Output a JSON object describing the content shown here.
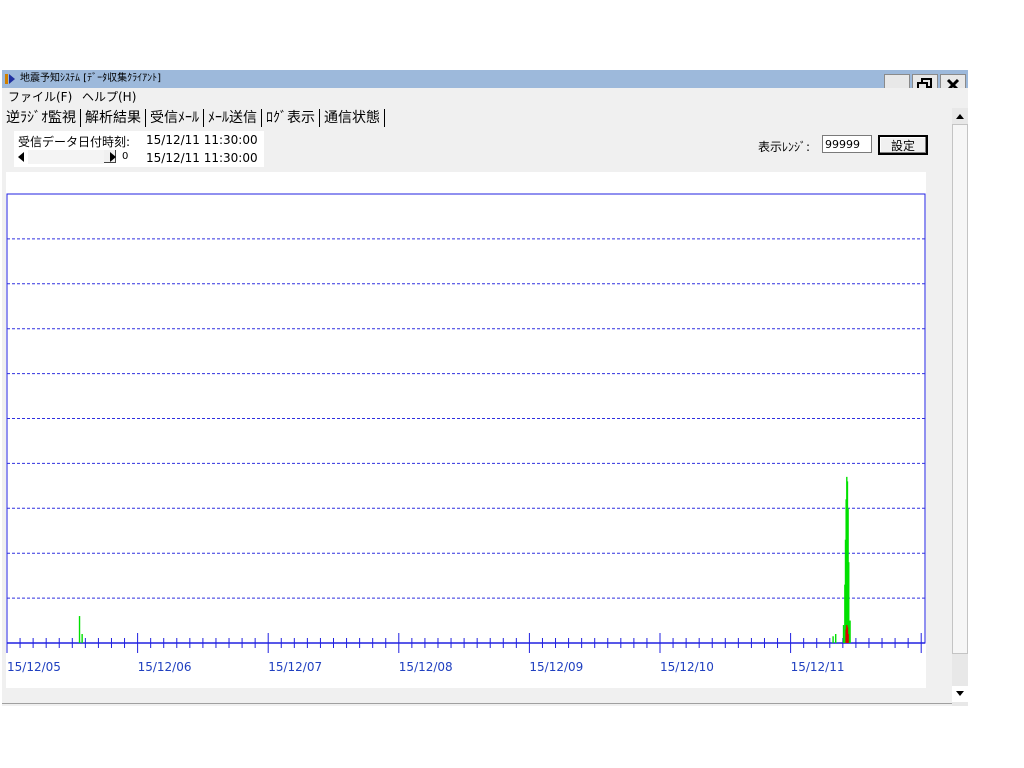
{
  "window": {
    "title": "地震予知ｼｽﾃﾑ [ﾃﾞｰﾀ収集ｸﾗｲｱﾝﾄ]"
  },
  "menu": {
    "items": [
      "ファイル(F)",
      "ヘルプ(H)"
    ]
  },
  "tabs": [
    "逆ﾗｼﾞｵ監視",
    "解析結果",
    "受信ﾒｰﾙ",
    "ﾒｰﾙ送信",
    "ﾛｸﾞ表示",
    "通信状態"
  ],
  "info": {
    "received_label": "受信データ日付時刻:",
    "received_time": "15/12/11 11:30:00",
    "slider_value": "0",
    "current_time": "15/12/11 11:30:00"
  },
  "controls": {
    "range_label": "表示ﾚﾝｼﾞ:",
    "range_value": "99999",
    "set_label": "設定"
  },
  "colors": {
    "titlebar": "#9db9db",
    "axis": "#2020e0",
    "grid": "#3030e0",
    "tick_label": "#2040c0",
    "series_green": "#00e000",
    "series_red": "#e00000"
  },
  "chart_data": {
    "type": "bar",
    "x_tick_labels": [
      "15/12/05",
      "15/12/06",
      "15/12/07",
      "15/12/08",
      "15/12/09",
      "15/12/10",
      "15/12/11"
    ],
    "x_range_days": [
      0,
      7
    ],
    "ylim": [
      0,
      1
    ],
    "grid_lines": 9,
    "minor_ticks_per_day": 10,
    "series": [
      {
        "color": "green",
        "points": [
          {
            "t": 0.55,
            "v": 0.06
          },
          {
            "t": 0.57,
            "v": 0.02
          },
          {
            "t": 6.32,
            "v": 0.015
          },
          {
            "t": 6.34,
            "v": 0.02
          },
          {
            "t": 6.4,
            "v": 0.04
          },
          {
            "t": 6.41,
            "v": 0.13
          },
          {
            "t": 6.415,
            "v": 0.23
          },
          {
            "t": 6.42,
            "v": 0.32
          },
          {
            "t": 6.425,
            "v": 0.37
          },
          {
            "t": 6.43,
            "v": 0.36
          },
          {
            "t": 6.435,
            "v": 0.3
          },
          {
            "t": 6.44,
            "v": 0.18
          },
          {
            "t": 6.45,
            "v": 0.05
          }
        ]
      },
      {
        "color": "red",
        "points": [
          {
            "t": 6.42,
            "v": 0.03
          },
          {
            "t": 6.425,
            "v": 0.04
          },
          {
            "t": 6.43,
            "v": 0.035
          },
          {
            "t": 6.435,
            "v": 0.02
          }
        ]
      }
    ]
  }
}
